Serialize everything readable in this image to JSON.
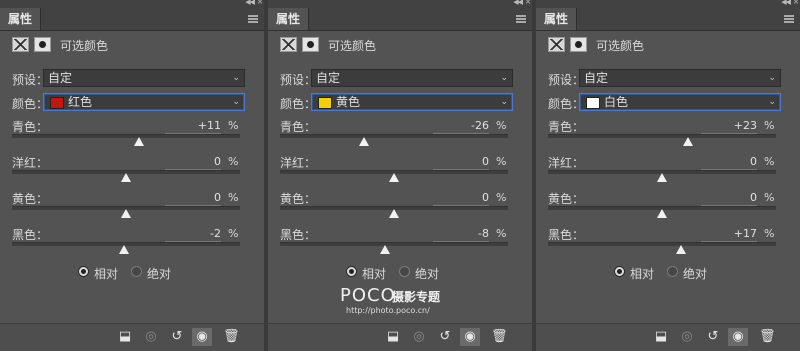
{
  "panels": [
    {
      "tab": "属性",
      "title": "可选颜色",
      "preset_label": "预设：",
      "preset_value": "自定",
      "color_label": "颜色：",
      "color_value": "红色",
      "swatch_color": "#c1170c",
      "sliders": [
        {
          "label": "青色：",
          "value": "+11",
          "unit": "%",
          "amount": 11
        },
        {
          "label": "洋红：",
          "value": "0",
          "unit": "%",
          "amount": 0
        },
        {
          "label": "黄色：",
          "value": "0",
          "unit": "%",
          "amount": 0
        },
        {
          "label": "黑色：",
          "value": "-2",
          "unit": "%",
          "amount": -2
        }
      ],
      "radio_relative": "相对",
      "radio_absolute": "绝对",
      "method": "relative"
    },
    {
      "tab": "属性",
      "title": "可选颜色",
      "preset_label": "预设：",
      "preset_value": "自定",
      "color_label": "颜色：",
      "color_value": "黄色",
      "swatch_color": "#f5d000",
      "sliders": [
        {
          "label": "青色：",
          "value": "-26",
          "unit": "%",
          "amount": -26
        },
        {
          "label": "洋红：",
          "value": "0",
          "unit": "%",
          "amount": 0
        },
        {
          "label": "黄色：",
          "value": "0",
          "unit": "%",
          "amount": 0
        },
        {
          "label": "黑色：",
          "value": "-8",
          "unit": "%",
          "amount": -8
        }
      ],
      "radio_relative": "相对",
      "radio_absolute": "绝对",
      "method": "relative"
    },
    {
      "tab": "属性",
      "title": "可选颜色",
      "preset_label": "预设：",
      "preset_value": "自定",
      "color_label": "颜色：",
      "color_value": "白色",
      "swatch_color": "#ffffff",
      "sliders": [
        {
          "label": "青色：",
          "value": "+23",
          "unit": "%",
          "amount": 23
        },
        {
          "label": "洋红：",
          "value": "0",
          "unit": "%",
          "amount": 0
        },
        {
          "label": "黄色：",
          "value": "0",
          "unit": "%",
          "amount": 0
        },
        {
          "label": "黑色：",
          "value": "+17",
          "unit": "%",
          "amount": 17
        }
      ],
      "radio_relative": "相对",
      "radio_absolute": "绝对",
      "method": "relative"
    }
  ],
  "footer_icons": [
    "clip-to-layer-icon",
    "view-previous-icon",
    "reset-icon",
    "visibility-eye-icon",
    "delete-trash-icon"
  ],
  "watermark": {
    "logo": "POCO",
    "text": "摄影专题",
    "url": "http://photo.poco.cn/"
  }
}
